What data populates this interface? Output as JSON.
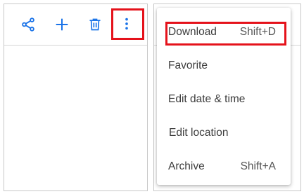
{
  "toolbar": {
    "icons": [
      "share-icon",
      "add-icon",
      "delete-icon",
      "more-vert-icon"
    ],
    "accent_color": "#1a73e8"
  },
  "highlight_color": "#e5121b",
  "menu": {
    "items": [
      {
        "label": "Download",
        "shortcut": "Shift+D"
      },
      {
        "label": "Favorite",
        "shortcut": ""
      },
      {
        "label": "Edit date & time",
        "shortcut": ""
      },
      {
        "label": "Edit location",
        "shortcut": ""
      },
      {
        "label": "Archive",
        "shortcut": "Shift+A"
      }
    ]
  }
}
